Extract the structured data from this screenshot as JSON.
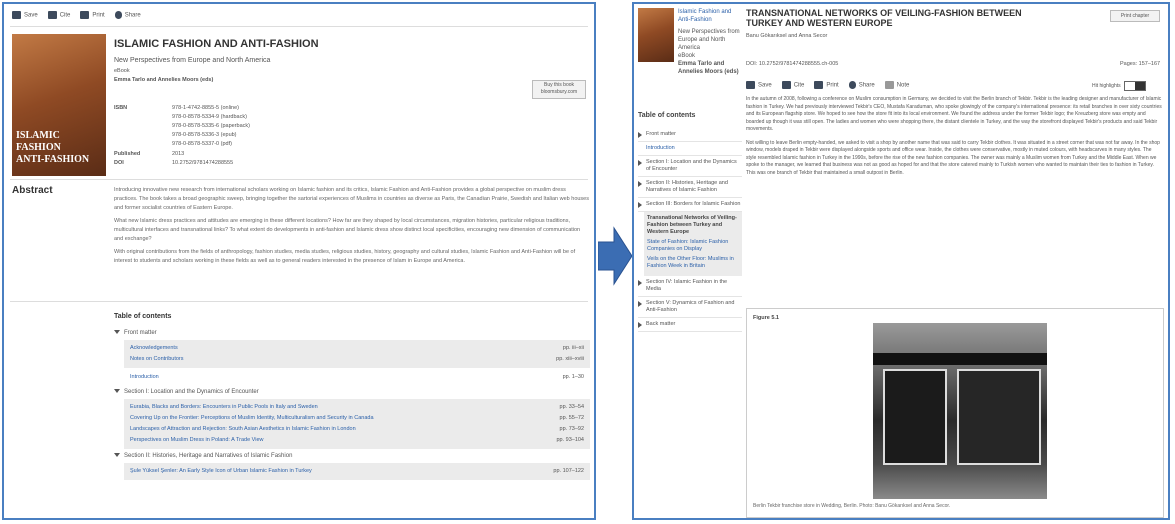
{
  "left": {
    "toolbar": {
      "save": "Save",
      "cite": "Cite",
      "print": "Print",
      "share": "Share"
    },
    "cover": {
      "line1": "ISLAMIC FASHION",
      "line2": "ANTI-FASHION"
    },
    "book": {
      "title": "ISLAMIC FASHION AND ANTI-FASHION",
      "subtitle": "New Perspectives from Europe and North America",
      "format": "eBook",
      "editors": "Emma Tarlo and Annelies Moors (eds)",
      "buy_button": "Buy this book bloomsbury.com",
      "isbn_label": "ISBN",
      "isbns": [
        "978-1-4742-8855-5 (online)",
        "978-0-8578-5334-9 (hardback)",
        "978-0-8578-5335-6 (paperback)",
        "978-0-8578-5336-3 (epub)",
        "978-0-8578-5337-0 (pdf)"
      ],
      "published_label": "Published",
      "published": "2013",
      "doi_label": "DOI",
      "doi": "10.2752/9781474288555"
    },
    "abstract": {
      "heading": "Abstract",
      "paragraphs": [
        "Introducing innovative new research from international scholars working on Islamic fashion and its critics, Islamic Fashion and Anti-Fashion provides a global perspective on muslim dress practices. The book takes a broad geographic sweep, bringing together the sartorial experiences of Muslims in countries as diverse as Paris, the Canadian Prairie, Swedish and Italian web houses and former socialist countries of Eastern Europe.",
        "What new Islamic dress practices and attitudes are emerging in these different locations? How far are they shaped by local circumstances, migration histories, particular religious traditions, multicultural interfaces and transnational links? To what extent do developments in anti-fashion and Islamic dress show distinct local specificities, encouraging new dimension of communication and exchange?",
        "With original contributions from the fields of anthropology, fashion studies, media studies, religious studies, history, geography and cultural studies, Islamic Fashion and Anti-Fashion will be of interest to students and scholars working in these fields as well as to general readers interested in the presence of Islam in Europe and America."
      ]
    },
    "toc": {
      "heading": "Table of contents",
      "front_matter": "Front matter",
      "front_items": [
        {
          "label": "Acknowledgements",
          "pages": "pp. iii–xii"
        },
        {
          "label": "Notes on Contributors",
          "pages": "pp. xiii–xviii"
        }
      ],
      "introduction": {
        "label": "Introduction",
        "pages": "pp. 1–30"
      },
      "section1": "Section I: Location and the Dynamics of Encounter",
      "section1_items": [
        {
          "label": "Eurabia, Blacks and Borders: Encounters in Public Pools in Italy and Sweden",
          "pages": "pp. 33–54"
        },
        {
          "label": "Covering Up on the Frontier: Perceptions of Muslim Identity, Multiculturalism and Security in Canada",
          "pages": "pp. 55–72"
        },
        {
          "label": "Landscapes of Attraction and Rejection: South Asian Aesthetics in Islamic Fashion in London",
          "pages": "pp. 73–92"
        },
        {
          "label": "Perspectives on Muslim Dress in Poland: A Trade View",
          "pages": "pp. 93–104"
        }
      ],
      "section2": "Section II: Histories, Heritage and Narratives of Islamic Fashion",
      "section2_items": [
        {
          "label": "Şule Yüksel Şenler: An Early Style Icon of Urban Islamic Fashion in Turkey",
          "pages": "pp. 107–122"
        }
      ]
    }
  },
  "right": {
    "book_title": "Islamic Fashion and Anti-Fashion",
    "book_subtitle": "New Perspectives from Europe and North America",
    "format": "eBook",
    "editors": "Emma Tarlo and Annelies Moors (eds)",
    "chapter_title": "TRANSNATIONAL NETWORKS OF VEILING-FASHION BETWEEN TURKEY AND WESTERN EUROPE",
    "authors": "Banu Gökarıksel and Anna Secor",
    "print_button": "Print chapter",
    "doi": "DOI: 10.2752/9781474288555.ch-005",
    "pages": "Pages: 157–167",
    "toolbar": {
      "save": "Save",
      "cite": "Cite",
      "print": "Print",
      "share": "Share",
      "more": "Note"
    },
    "highlights_label": "Hit highlights",
    "toc": {
      "heading": "Table of contents",
      "items": [
        "Front matter",
        "Introduction",
        "Section I: Location and the Dynamics of Encounter",
        "Section II: Histories, Heritage and Narratives of Islamic Fashion",
        "Section III: Borders for Islamic Fashion"
      ],
      "sub_active": "Transnational Networks of Veiling-Fashion between Turkey and Western Europe",
      "sub_items": [
        "State of Fashion: Islamic Fashion Companies on Display",
        "Veils on the Other Floor: Muslims in Fashion Week in Britain"
      ],
      "items_after": [
        "Section IV: Islamic Fashion in the Media",
        "Section V: Dynamics of Fashion and Anti-Fashion",
        "Back matter"
      ]
    },
    "body": [
      "In the autumn of 2008, following a conference on Muslim consumption in Germany, we decided to visit the Berlin branch of Tekbir. Tekbir is the leading designer and manufacturer of Islamic fashion in Turkey. We had previously interviewed Tekbir's CEO, Mustafa Karaduman, who spoke glowingly of the company's international presence: its retail branches in over sixty countries and its European flagship store. We hoped to see how the store fit into its local environment. We found the address under the former Tekbir logo; the Kreuzberg store was empty and boarded up though it was still open. The ladies and women who were shopping there, the distant clientele in Turkey, and the way the storefront displayed Tekbir's products and said Tekbir movements.",
      "Not willing to leave Berlin empty-handed, we asked to visit a shop by another name that was said to carry Tekbir clothes. It was situated in a street corner that was not far away. In the shop window, models draped in Tekbir were displayed alongside sports and office wear. Inside, the clothes were conservative, mostly in muted colours, with headscarves in many styles. The style resembled Islamic fashion in Turkey in the 1990s, before the rise of the new fashion companies. The owner was mainly a Muslim women from Turkey and the Middle East. When we spoke to the manager, we learned that business was not as good as hoped for and that the store catered mainly to Turkish women who wanted to maintain their ties to fashion in Turkey. This was one branch of Tekbir that maintained a small outpost in Berlin."
    ],
    "figure": {
      "label": "Figure 5.1",
      "caption": "Berlin Tekbir franchise store in Wedding, Berlin. Photo: Banu Gökarıksel and Anna Secor."
    }
  },
  "colors": {
    "border": "#4a7fc1",
    "arrow": "#3b6db3",
    "link": "#2a5fa8",
    "highlight": "#8fd37a"
  }
}
